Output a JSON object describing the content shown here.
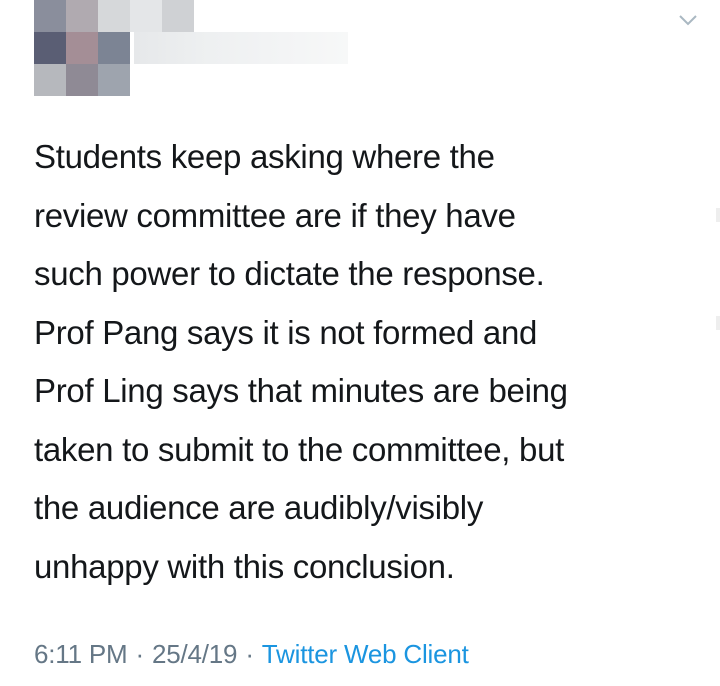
{
  "tweet": {
    "text": "Students keep asking where the\nreview committee are if they have\nsuch power to dictate the response.\nProf Pang says it is not formed and\nProf Ling says that minutes are being\ntaken to submit to the committee, but\nthe audience are audibly/visibly\nunhappy with this conclusion.",
    "time": "6:11 PM",
    "separator": "·",
    "date": "25/4/19",
    "client": "Twitter Web Client"
  },
  "icons": {
    "caret": "chevron-down-icon"
  },
  "colors": {
    "text": "#14171a",
    "meta": "#657786",
    "link": "#1b95e0",
    "background": "#ffffff"
  }
}
